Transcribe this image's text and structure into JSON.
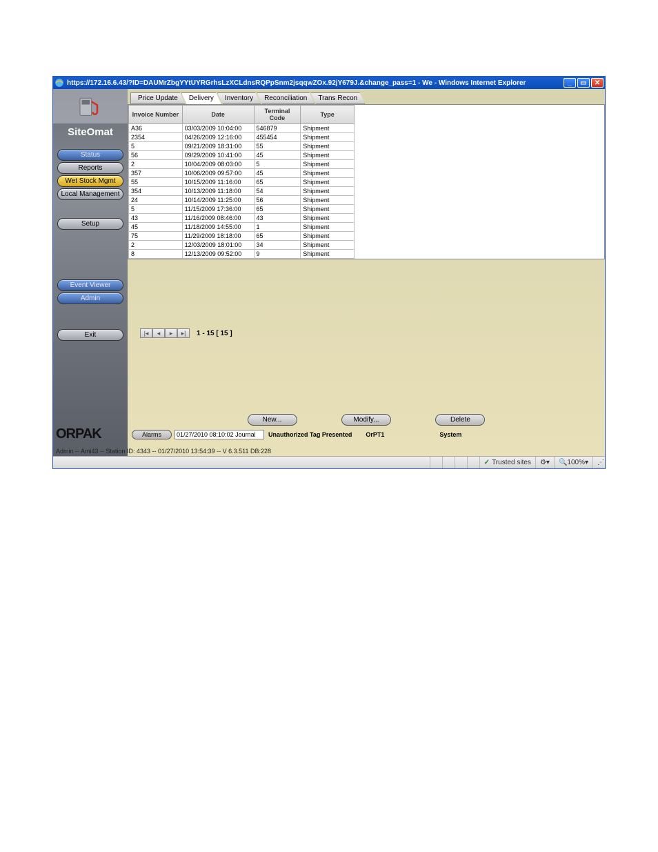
{
  "window": {
    "title": "https://172.16.6.43/?ID=DAUMrZbgYYtUYRGrhsLzXCLdnsRQPpSnm2jsqqwZOx.92jY679J.&change_pass=1 - We - Windows Internet Explorer"
  },
  "brand": "SiteOmat",
  "nav": [
    {
      "label": "Status",
      "style": "blue"
    },
    {
      "label": "Reports",
      "style": "grey"
    },
    {
      "label": "Wet Stock Mgmt",
      "style": "yellow"
    },
    {
      "label": "Local Management",
      "style": "grey"
    }
  ],
  "nav2": [
    {
      "label": "Setup",
      "style": "grey"
    }
  ],
  "nav3": [
    {
      "label": "Event Viewer",
      "style": "blue"
    },
    {
      "label": "Admin",
      "style": "blue"
    }
  ],
  "nav4": [
    {
      "label": "Exit",
      "style": "grey"
    }
  ],
  "orpak": "ORPAK",
  "tabs": [
    "Price Update",
    "Delivery",
    "Inventory",
    "Reconciliation",
    "Trans Recon"
  ],
  "active_tab": 1,
  "columns": [
    "Invoice Number",
    "Date",
    "Terminal Code",
    "Type"
  ],
  "rows": [
    {
      "c0": "A36",
      "c1": "03/03/2009 10:04:00",
      "c2": "546879",
      "c3": "Shipment"
    },
    {
      "c0": "2354",
      "c1": "04/26/2009 12:16:00",
      "c2": "455454",
      "c3": "Shipment"
    },
    {
      "c0": "5",
      "c1": "09/21/2009 18:31:00",
      "c2": "55",
      "c3": "Shipment"
    },
    {
      "c0": "56",
      "c1": "09/29/2009 10:41:00",
      "c2": "45",
      "c3": "Shipment"
    },
    {
      "c0": "2",
      "c1": "10/04/2009 08:03:00",
      "c2": "5",
      "c3": "Shipment"
    },
    {
      "c0": "357",
      "c1": "10/06/2009 09:57:00",
      "c2": "45",
      "c3": "Shipment"
    },
    {
      "c0": "55",
      "c1": "10/15/2009 11:16:00",
      "c2": "65",
      "c3": "Shipment"
    },
    {
      "c0": "354",
      "c1": "10/13/2009 11:18:00",
      "c2": "54",
      "c3": "Shipment"
    },
    {
      "c0": "24",
      "c1": "10/14/2009 11:25:00",
      "c2": "56",
      "c3": "Shipment"
    },
    {
      "c0": "5",
      "c1": "11/15/2009 17:36:00",
      "c2": "65",
      "c3": "Shipment"
    },
    {
      "c0": "43",
      "c1": "11/16/2009 08:46:00",
      "c2": "43",
      "c3": "Shipment"
    },
    {
      "c0": "45",
      "c1": "11/18/2009 14:55:00",
      "c2": "1",
      "c3": "Shipment"
    },
    {
      "c0": "75",
      "c1": "11/29/2009 18:18:00",
      "c2": "65",
      "c3": "Shipment"
    },
    {
      "c0": "2",
      "c1": "12/03/2009 18:01:00",
      "c2": "34",
      "c3": "Shipment"
    },
    {
      "c0": "8",
      "c1": "12/13/2009 09:52:00",
      "c2": "9",
      "c3": "Shipment"
    }
  ],
  "pager": {
    "text": "1 - 15  [ 15 ]"
  },
  "actions": {
    "new": "New...",
    "modify": "Modify...",
    "delete": "Delete"
  },
  "alarm": {
    "btn": "Alarms",
    "value": "01/27/2010 08:10:02 Journal",
    "text1": "Unauthorized Tag Presented",
    "text2": "OrPT1",
    "text3": "System"
  },
  "status_line": "Admin -- Ami43 -- Station ID: 4343 -- 01/27/2010 13:54:39 -- V 6.3.511 DB:228",
  "ie_status": {
    "trusted": "Trusted sites",
    "zoom": "100%"
  }
}
